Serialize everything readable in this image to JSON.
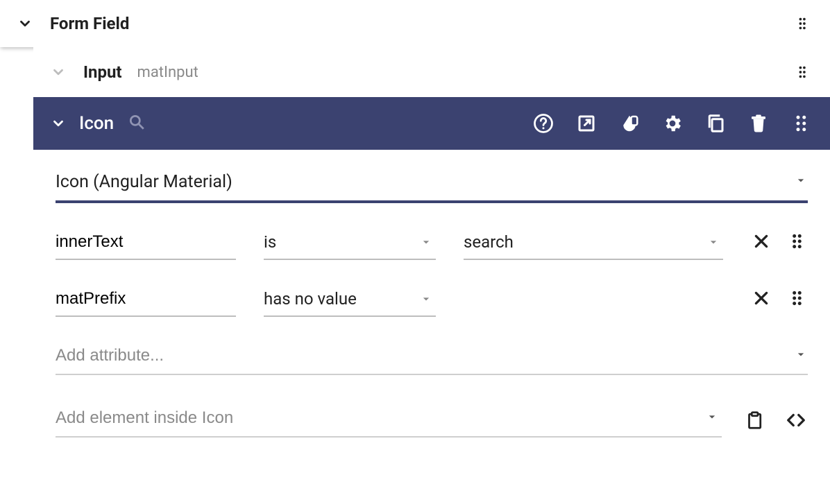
{
  "outer": {
    "title": "Form Field"
  },
  "input": {
    "title": "Input",
    "directive": "matInput"
  },
  "icon": {
    "title": "Icon",
    "type_label": "Icon (Angular Material)",
    "attributes": [
      {
        "name": "innerText",
        "op": "is",
        "value": "search"
      },
      {
        "name": "matPrefix",
        "op": "has no value",
        "value": ""
      }
    ],
    "add_attribute_placeholder": "Add attribute...",
    "add_element_placeholder": "Add element inside Icon"
  },
  "colors": {
    "header_bg": "#3b4270"
  }
}
